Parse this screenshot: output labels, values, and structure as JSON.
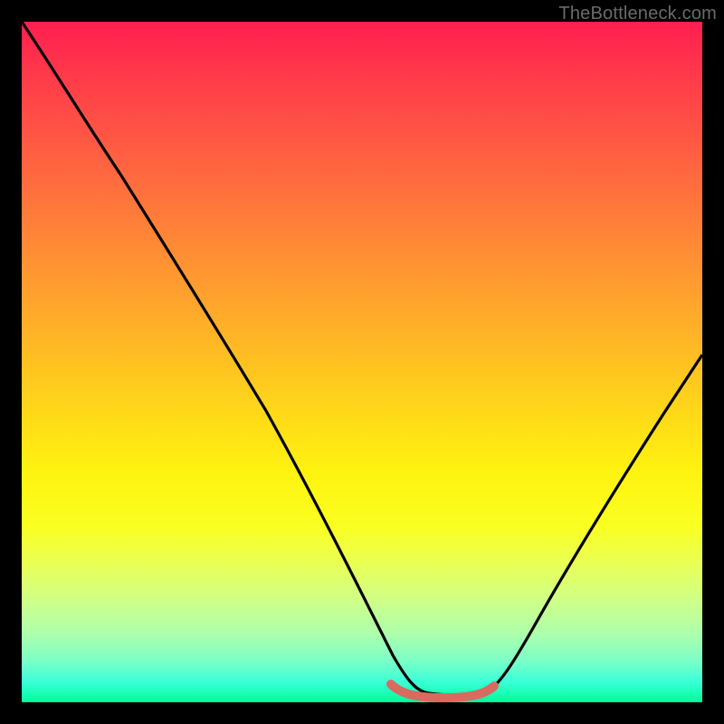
{
  "watermark": "TheBottleneck.com",
  "chart_data": {
    "type": "line",
    "title": "",
    "xlabel": "",
    "ylabel": "",
    "xlim": [
      0,
      100
    ],
    "ylim": [
      0,
      100
    ],
    "series": [
      {
        "name": "bottleneck-curve",
        "x": [
          0,
          8,
          16,
          24,
          32,
          40,
          48,
          54,
          58,
          60,
          62,
          64,
          66,
          68,
          72,
          80,
          88,
          96,
          100
        ],
        "values": [
          100,
          90,
          78,
          66,
          54,
          40,
          26,
          12,
          3,
          1,
          1,
          1,
          1,
          3,
          10,
          24,
          38,
          52,
          58
        ]
      },
      {
        "name": "optimal-band",
        "x": [
          54,
          56,
          58,
          60,
          62,
          64,
          66,
          68
        ],
        "values": [
          2,
          1,
          1,
          1,
          1,
          1,
          1,
          2
        ]
      }
    ],
    "annotations": [],
    "colors": {
      "gradient_top": "#ff1e50",
      "gradient_mid": "#ffee00",
      "gradient_bottom": "#00ff99",
      "curve": "#000000",
      "optimal_band": "#d86a5f"
    }
  }
}
